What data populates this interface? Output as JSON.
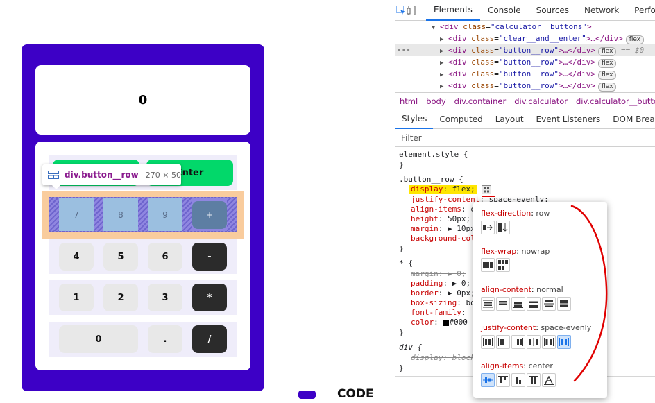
{
  "calculator": {
    "display": "0",
    "row0": [
      "",
      "Enter"
    ],
    "highlight_row": [
      "7",
      "8",
      "9",
      "+"
    ],
    "rows": [
      [
        "4",
        "5",
        "6",
        "-"
      ],
      [
        "1",
        "2",
        "3",
        "*"
      ],
      [
        "0",
        ".",
        "/"
      ]
    ],
    "tooltip": {
      "name": "div.button__row",
      "size": "270 × 50"
    },
    "logo_text": "CODE"
  },
  "devtools": {
    "tabs": [
      "Elements",
      "Console",
      "Sources",
      "Network",
      "Perfo"
    ],
    "active_tab": "Elements",
    "dom": [
      {
        "open": "<div",
        "cls": "calculator__buttons",
        "tail": ">",
        "badge": "",
        "indent": 1,
        "arrow": "▼"
      },
      {
        "open": "<div",
        "cls": "clear__and__enter",
        "tail": ">…</div>",
        "badge": "flex",
        "indent": 2,
        "arrow": "▶"
      },
      {
        "open": "<div",
        "cls": "button__row",
        "tail": ">…</div>",
        "badge": "flex",
        "indent": 2,
        "arrow": "▶",
        "eq": "== $0"
      },
      {
        "open": "<div",
        "cls": "button__row",
        "tail": ">…</div>",
        "badge": "flex",
        "indent": 2,
        "arrow": "▶"
      },
      {
        "open": "<div",
        "cls": "button__row",
        "tail": ">…</div>",
        "badge": "flex",
        "indent": 2,
        "arrow": "▶"
      },
      {
        "open": "<div",
        "cls": "button__row",
        "tail": ">…</div>",
        "badge": "flex",
        "indent": 2,
        "arrow": "▶"
      }
    ],
    "dots": "•••",
    "breadcrumbs": [
      "html",
      "body",
      "div.container",
      "div.calculator",
      "div.calculator__buttons"
    ],
    "style_tabs": [
      "Styles",
      "Computed",
      "Layout",
      "Event Listeners",
      "DOM Breakpoints"
    ],
    "filter_placeholder": "Filter",
    "rules": {
      "element_style": "element.style {",
      "close": "}",
      "button_row_selector": ".button__row {",
      "display_prop": "display",
      "display_val": "flex;",
      "justify_prop": "justify-content",
      "justify_val": "space-evenly;",
      "align_prop": "align-items",
      "align_val": "c",
      "height_prop": "height",
      "height_val": "50px;",
      "margin_prop": "margin",
      "margin_val": "▶ 10px",
      "bg_prop": "background-col",
      "star_selector": "* {",
      "star_margin": "margin: ▶ 0;",
      "star_padding_prop": "padding",
      "star_padding_val": "▶ 0;",
      "star_border_prop": "border",
      "star_border_val": "▶ 0px;",
      "star_boxsizing_prop": "box-sizing",
      "star_boxsizing_val": "bo",
      "star_font_prop": "font-family",
      "star_color_prop": "color",
      "star_color_val": "#000",
      "div_selector": "div {",
      "div_display": "display: block"
    },
    "flex_popup": {
      "direction": {
        "name": "flex-direction",
        "value": "row"
      },
      "wrap": {
        "name": "flex-wrap",
        "value": "nowrap"
      },
      "align_content": {
        "name": "align-content",
        "value": "normal"
      },
      "justify": {
        "name": "justify-content",
        "value": "space-evenly"
      },
      "align_items": {
        "name": "align-items",
        "value": "center"
      }
    }
  },
  "colors": {
    "calculator_bg": "#3d00c6",
    "green_button": "#02d86a",
    "dark_button": "#2b2b2b",
    "annotation_red": "#e00000"
  }
}
